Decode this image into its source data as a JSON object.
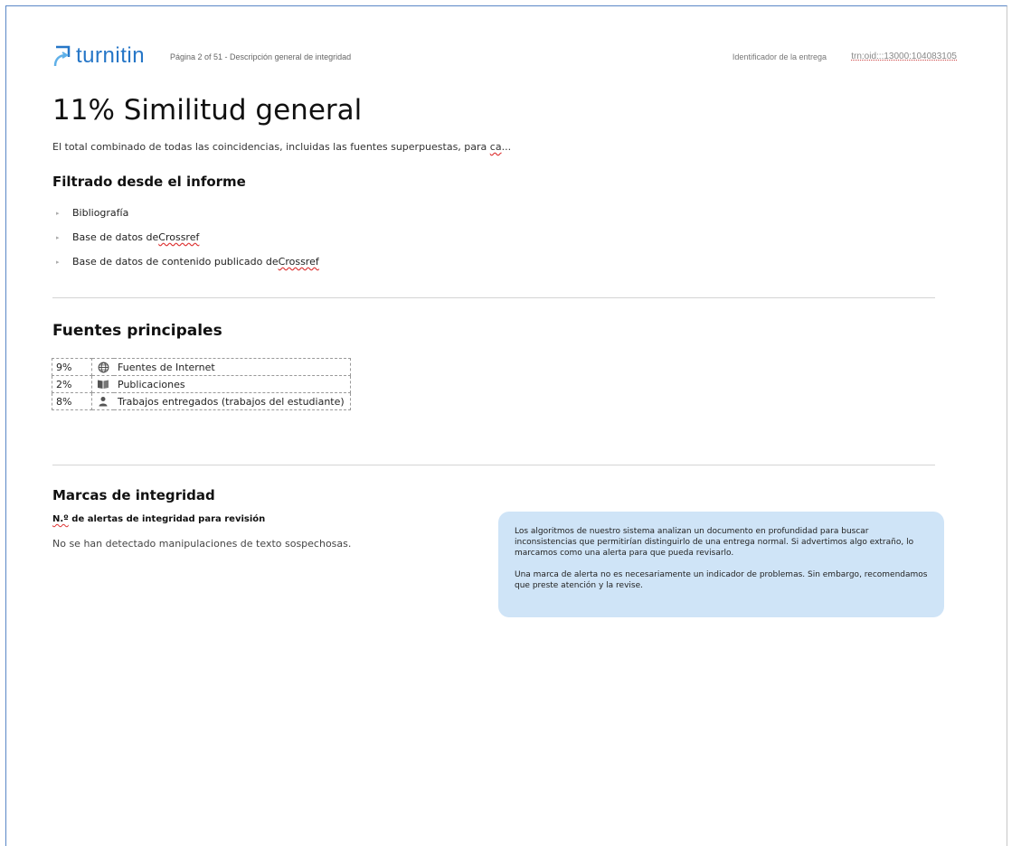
{
  "header": {
    "logo_text": "turnitin",
    "page_info": "Página 2 of 51 - Descripción general de integridad",
    "submission_id_label": "Identificador de la entrega",
    "submission_id_value": "trn:oid:::13000:104083105"
  },
  "summary": {
    "title": "11% Similitud general",
    "description_main": "El total combinado de todas las coincidencias, incluidas las fuentes superpuestas, para ",
    "description_flagged": "ca",
    "description_ellipsis": "..."
  },
  "filtered": {
    "heading": "Filtrado desde el informe",
    "items": [
      {
        "text": "Bibliografía",
        "flagged": ""
      },
      {
        "text": "Base de datos de ",
        "flagged": "Crossref"
      },
      {
        "text": "Base de datos de contenido publicado de ",
        "flagged": "Crossref"
      }
    ]
  },
  "sources": {
    "heading": "Fuentes principales",
    "rows": [
      {
        "percent": "9%",
        "icon": "globe-icon",
        "label": "Fuentes de Internet"
      },
      {
        "percent": "2%",
        "icon": "book-icon",
        "label": "Publicaciones"
      },
      {
        "percent": "8%",
        "icon": "person-icon",
        "label": "Trabajos entregados (trabajos del estudiante)"
      }
    ]
  },
  "integrity": {
    "heading": "Marcas de integridad",
    "alerts_label_flagged": "N.º",
    "alerts_label_rest": " de alertas de integridad para revisión",
    "no_alerts_text": "No se han detectado manipulaciones de texto sospechosas.",
    "info_paragraph_1": "Los algoritmos de nuestro sistema analizan un documento en profundidad para buscar inconsistencias que permitirían distinguirlo de una entrega normal. Si advertimos algo extraño, lo marcamos como una alerta para que pueda revisarlo.",
    "info_paragraph_2": "Una marca de alerta no es necesariamente un indicador de problemas. Sin embargo, recomendamos que preste atención y la revise."
  },
  "colors": {
    "brand": "#2576c7",
    "info_box_bg": "#cfe4f7",
    "spellcheck_underline": "#d33"
  }
}
